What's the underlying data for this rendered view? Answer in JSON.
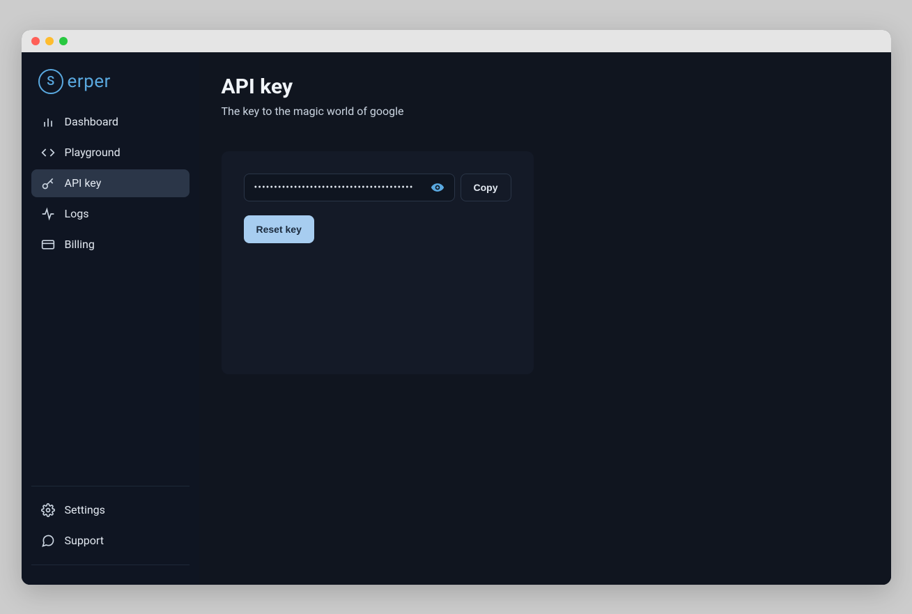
{
  "brand": {
    "logo_letter": "S",
    "logo_text": "erper"
  },
  "sidebar": {
    "primary": [
      {
        "label": "Dashboard",
        "icon": "bar-chart-icon",
        "active": false
      },
      {
        "label": "Playground",
        "icon": "code-icon",
        "active": false
      },
      {
        "label": "API key",
        "icon": "key-icon",
        "active": true
      },
      {
        "label": "Logs",
        "icon": "activity-icon",
        "active": false
      },
      {
        "label": "Billing",
        "icon": "credit-card-icon",
        "active": false
      }
    ],
    "secondary": [
      {
        "label": "Settings",
        "icon": "gear-icon"
      },
      {
        "label": "Support",
        "icon": "message-icon"
      }
    ]
  },
  "page": {
    "title": "API key",
    "subtitle": "The key to the magic world of google"
  },
  "api_key": {
    "masked_value": "••••••••••••••••••••••••••••••••••••••••",
    "copy_label": "Copy",
    "reset_label": "Reset key"
  }
}
